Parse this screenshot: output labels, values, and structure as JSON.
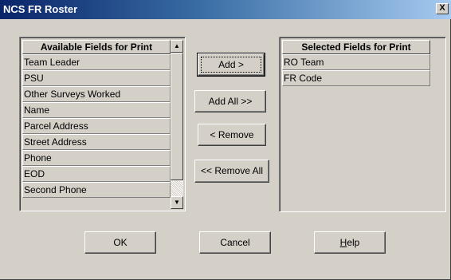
{
  "window": {
    "title": "NCS FR Roster",
    "close_glyph": "X"
  },
  "available": {
    "header": "Available Fields for Print",
    "items": [
      "Team Leader",
      "PSU",
      "Other Surveys Worked",
      "Name",
      "Parcel Address",
      "Street Address",
      "Phone",
      "EOD",
      "Second Phone"
    ],
    "scroll_up_glyph": "▲",
    "scroll_down_glyph": "▼"
  },
  "selected": {
    "header": "Selected Fields for Print",
    "items": [
      "RO Team",
      "FR Code"
    ]
  },
  "actions": {
    "add_label": "Add >",
    "add_all_label": "Add All >>",
    "remove_label": "< Remove",
    "remove_all_label": "<< Remove All"
  },
  "footer": {
    "ok_label": "OK",
    "cancel_label": "Cancel",
    "help_mnemonic": "H",
    "help_rest": "elp"
  }
}
